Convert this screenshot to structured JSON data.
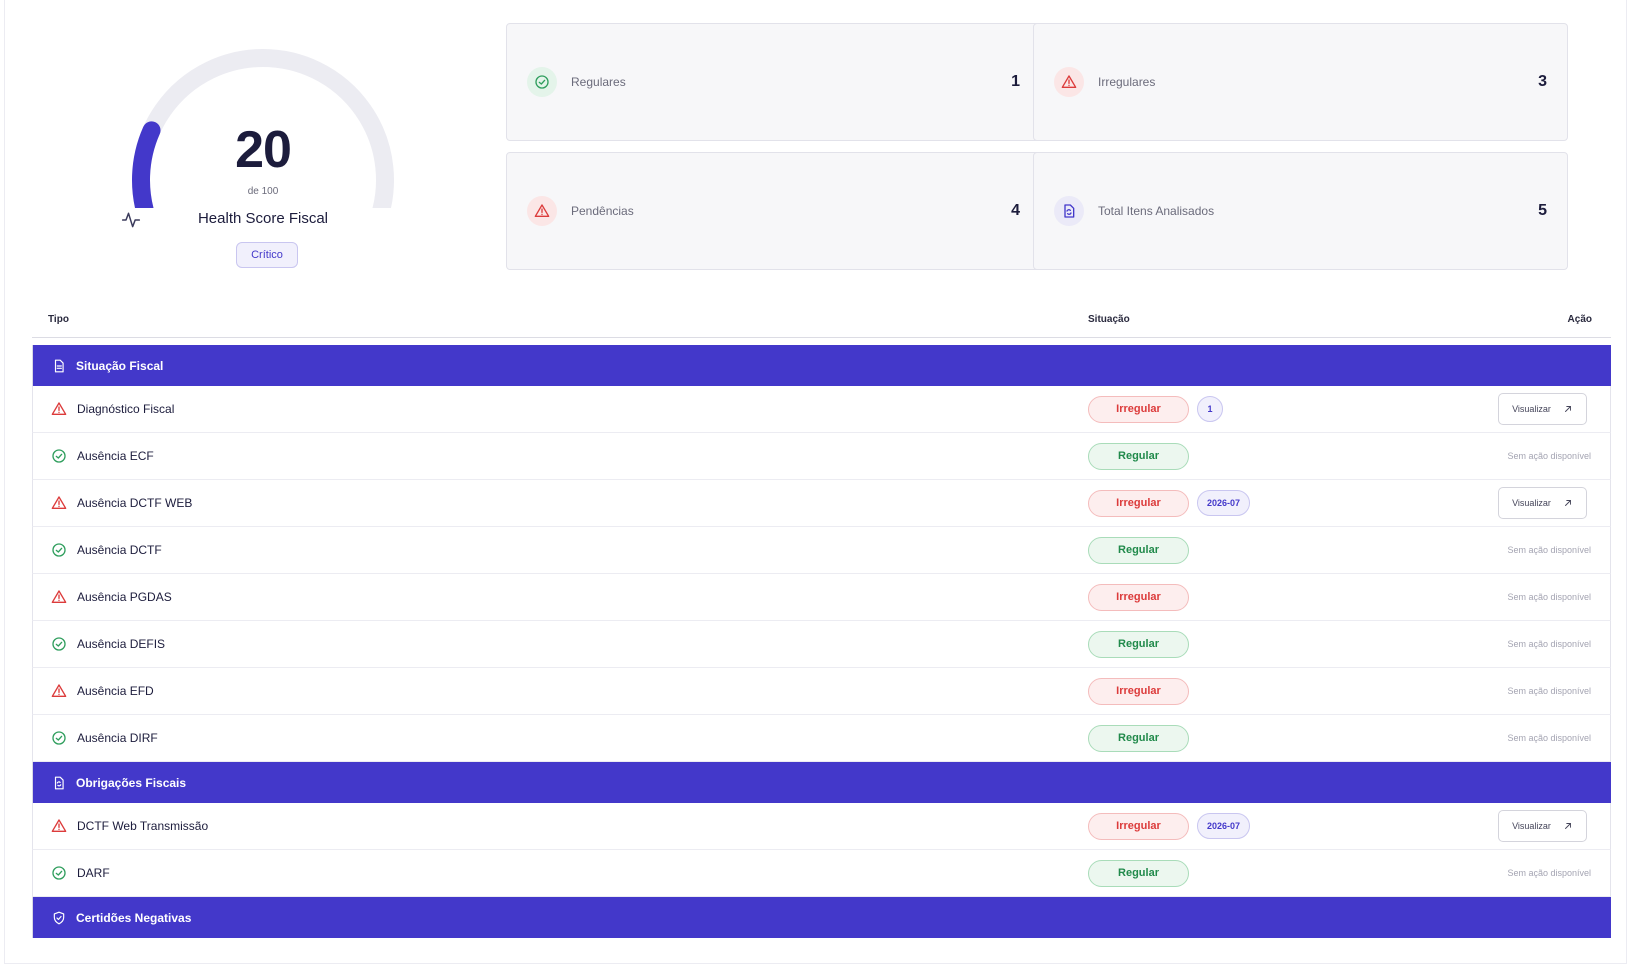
{
  "colors": {
    "accent": "#4338ca",
    "regular": "#218a4b",
    "irregular": "#dc3b3b",
    "gauge_track": "#ececf2"
  },
  "score": {
    "value": "20",
    "max_label": "de 100",
    "level": 0.2,
    "label": "Health Score Fiscal",
    "badge": "Crítico",
    "icon": "activity-pulse-icon"
  },
  "stats": [
    {
      "label": "Regulares",
      "value": "1",
      "icon": "check-circle-icon",
      "tone": "green"
    },
    {
      "label": "Irregulares",
      "value": "3",
      "icon": "alert-triangle-icon",
      "tone": "red"
    },
    {
      "label": "Pendências",
      "value": "4",
      "icon": "alert-triangle-icon",
      "tone": "red"
    },
    {
      "label": "Total Itens Analisados",
      "value": "5",
      "icon": "file-sync-icon",
      "tone": "indigo"
    }
  ],
  "table": {
    "headers": {
      "tipo": "Tipo",
      "situacao": "Situação",
      "acao": "Ação"
    },
    "view_label": "Visualizar",
    "no_action_label": "Sem ação disponível",
    "groups": [
      {
        "title": "Situação Fiscal",
        "icon": "file-text-icon",
        "rows": [
          {
            "name": "Diagnóstico Fiscal",
            "status": "Irregular",
            "extra": "1",
            "action": true
          },
          {
            "name": "Ausência ECF",
            "status": "Regular",
            "extra": "",
            "action": false
          },
          {
            "name": "Ausência DCTF WEB",
            "status": "Irregular",
            "extra": "2026-07",
            "action": true
          },
          {
            "name": "Ausência DCTF",
            "status": "Regular",
            "extra": "",
            "action": false
          },
          {
            "name": "Ausência PGDAS",
            "status": "Irregular",
            "extra": "",
            "action": false
          },
          {
            "name": "Ausência DEFIS",
            "status": "Regular",
            "extra": "",
            "action": false
          },
          {
            "name": "Ausência EFD",
            "status": "Irregular",
            "extra": "",
            "action": false
          },
          {
            "name": "Ausência DIRF",
            "status": "Regular",
            "extra": "",
            "action": false
          }
        ]
      },
      {
        "title": "Obrigações Fiscais",
        "icon": "file-sync-icon",
        "rows": [
          {
            "name": "DCTF Web Transmissão",
            "status": "Irregular",
            "extra": "2026-07",
            "action": true
          },
          {
            "name": "DARF",
            "status": "Regular",
            "extra": "",
            "action": false
          }
        ]
      },
      {
        "title": "Certidões Negativas",
        "icon": "shield-check-icon",
        "rows": []
      }
    ]
  }
}
